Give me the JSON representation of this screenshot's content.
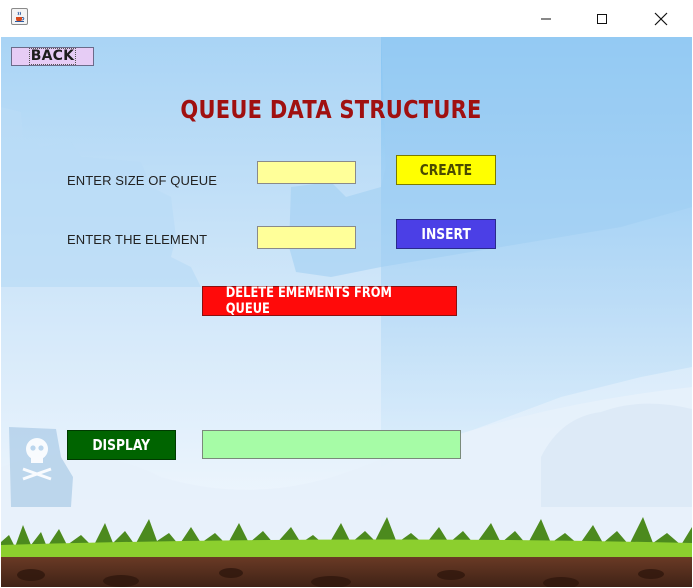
{
  "window": {
    "minimize_icon": "minimize-icon",
    "maximize_icon": "maximize-icon",
    "close_icon": "close-icon",
    "app_icon": "java-cup-icon"
  },
  "back_button": {
    "label": "BACK"
  },
  "title": "QUEUE DATA STRUCTURE",
  "size_section": {
    "label": "ENTER SIZE OF QUEUE",
    "input_value": "",
    "button_label": "CREATE"
  },
  "element_section": {
    "label": "ENTER THE ELEMENT",
    "input_value": "",
    "button_label": "INSERT"
  },
  "delete_button": {
    "label": "DELETE EMEMENTS FROM QUEUE"
  },
  "display_section": {
    "button_label": "DISPLAY",
    "output_value": ""
  },
  "colors": {
    "title": "#a01010",
    "create_button": "#ffff00",
    "insert_button": "#4b3fe6",
    "delete_button": "#ff0a0a",
    "display_button": "#006400",
    "input_fields": "#ffff99",
    "display_output": "#a6fca6",
    "back_button": "#e6ccf5"
  }
}
